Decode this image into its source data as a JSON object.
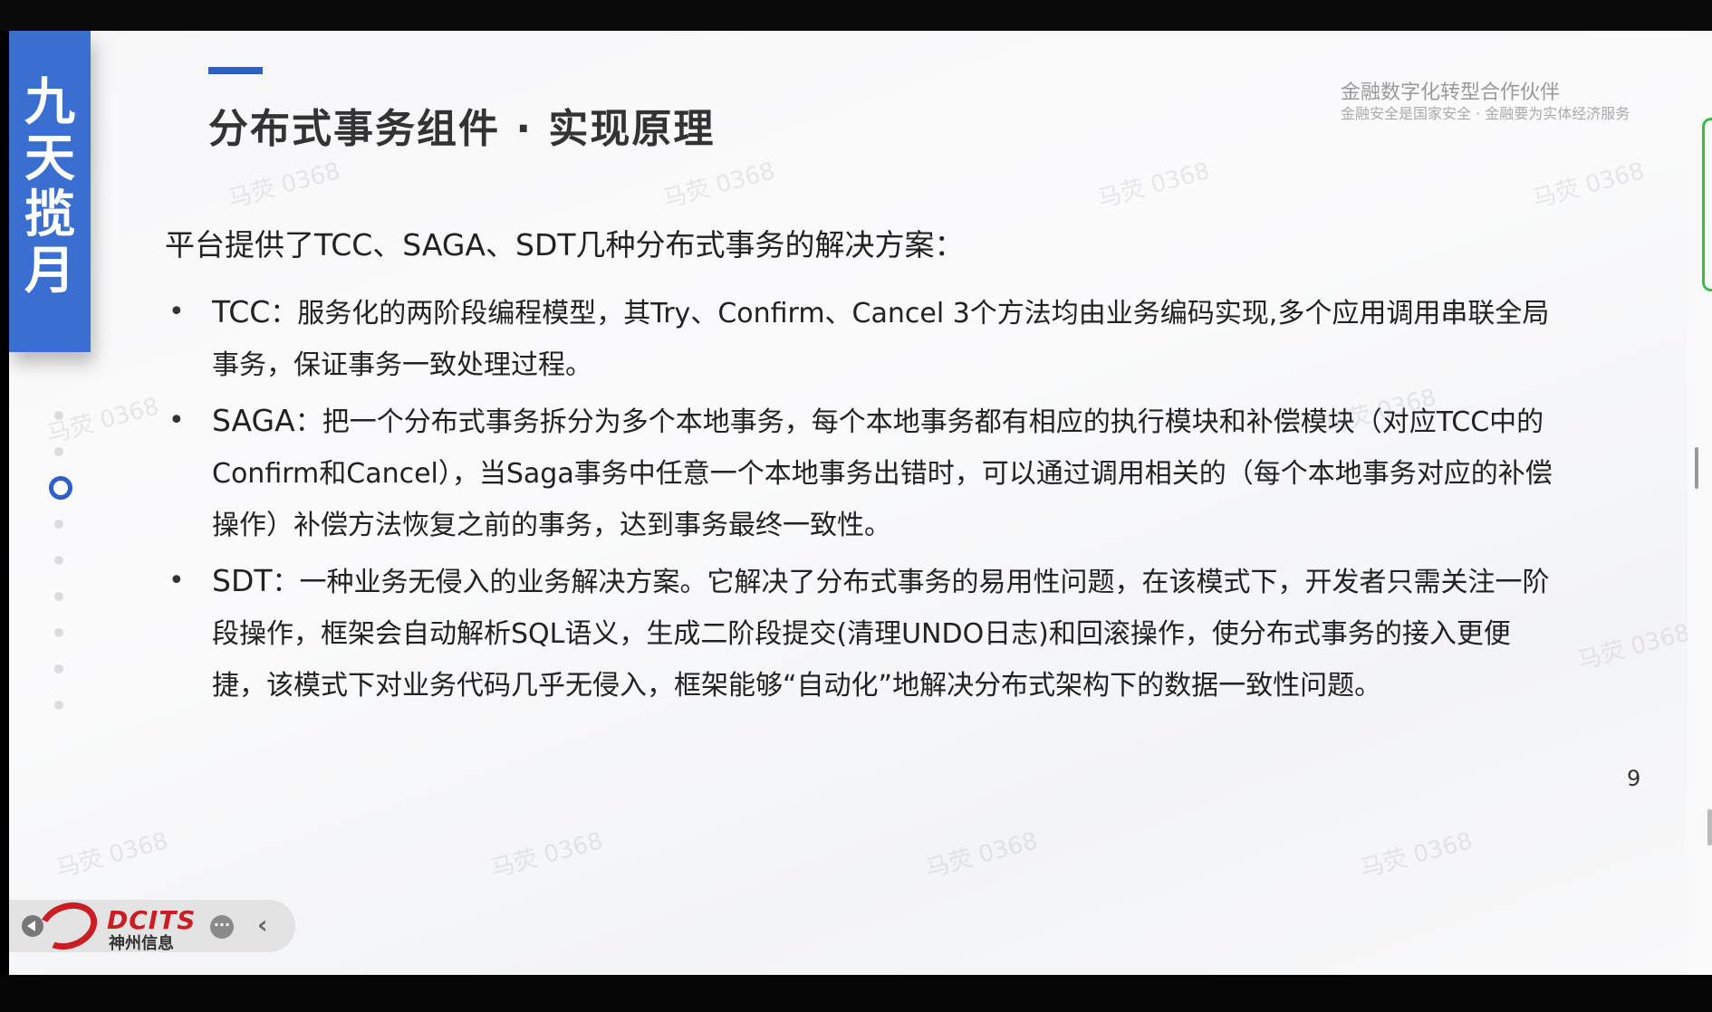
{
  "slide": {
    "brand_vertical": "九\n天\n揽\n月",
    "title": "分布式事务组件 · 实现原理",
    "tagline_main": "金融数字化转型合作伙伴",
    "tagline_sub": "金融安全是国家安全 · 金融要为实体经济服务",
    "intro": "平台提供了TCC、SAGA、SDT几种分布式事务的解决方案：",
    "bullets": [
      {
        "term": "TCC",
        "text": "：服务化的两阶段编程模型，其Try、Confirm、Cancel 3个方法均由业务编码实现,多个应用调用串联全局事务，保证事务一致处理过程。"
      },
      {
        "term": "SAGA",
        "text": "：把一个分布式事务拆分为多个本地事务，每个本地事务都有相应的执行模块和补偿模块（对应TCC中的Confirm和Cancel），当Saga事务中任意一个本地事务出错时，可以通过调用相关的（每个本地事务对应的补偿操作）补偿方法恢复之前的事务，达到事务最终一致性。"
      },
      {
        "term": "SDT",
        "text": "：一种业务无侵入的业务解决方案。它解决了分布式事务的易用性问题，在该模式下，开发者只需关注一阶段操作，框架会自动解析SQL语义，生成二阶段提交(清理UNDO日志)和回滚操作，使分布式事务的接入更便捷，该模式下对业务代码几乎无侵入，框架能够“自动化”地解决分布式架构下的数据一致性问题。"
      }
    ],
    "page_number": "9",
    "watermark": "马荧 0368",
    "nav": {
      "dot_count": 9,
      "active_index": 2
    }
  },
  "toolbar": {
    "logo_text": "DCITS",
    "logo_cn": "神州信息",
    "more_icon": "ellipsis-icon",
    "back_icon": "chevron-left-icon"
  },
  "colors": {
    "accent": "#2f5fc8",
    "brand_box": "#3a6fd1",
    "logo_red": "#c81e24"
  }
}
